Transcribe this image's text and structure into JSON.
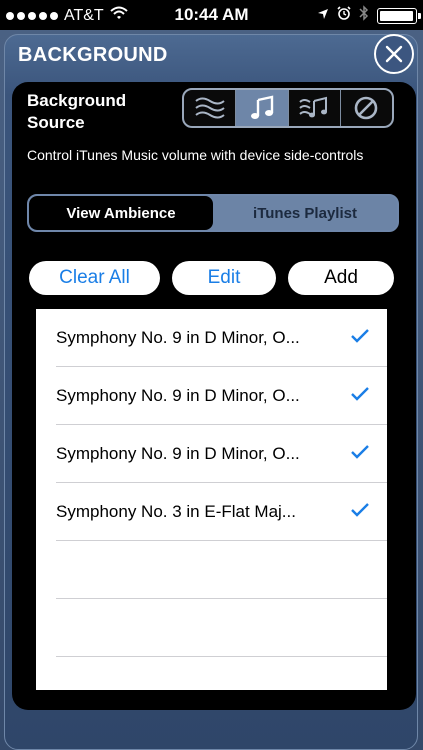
{
  "status": {
    "carrier": "AT&T",
    "time": "10:44 AM"
  },
  "header": {
    "title": "BACKGROUND"
  },
  "source": {
    "label_line1": "Background",
    "label_line2": "Source",
    "options": [
      "ambience-waves-icon",
      "music-note-icon",
      "mixed-icon",
      "none-icon"
    ],
    "selected_index": 1
  },
  "description": "Control iTunes Music volume with device side-controls",
  "toggle": {
    "left": "View Ambience",
    "right": "iTunes Playlist",
    "selected": "left"
  },
  "actions": {
    "clear": "Clear All",
    "edit": "Edit",
    "add": "Add"
  },
  "playlist": {
    "items": [
      {
        "title": "Symphony No. 9 in D Minor, O...",
        "checked": true
      },
      {
        "title": "Symphony No. 9 in D Minor, O...",
        "checked": true
      },
      {
        "title": "Symphony No. 9 in D Minor, O...",
        "checked": true
      },
      {
        "title": "Symphony No. 3 in E-Flat Maj...",
        "checked": true
      }
    ]
  },
  "colors": {
    "accent": "#1a7ee6",
    "panel": "#3b557c",
    "segment_active": "#6e86a8"
  }
}
